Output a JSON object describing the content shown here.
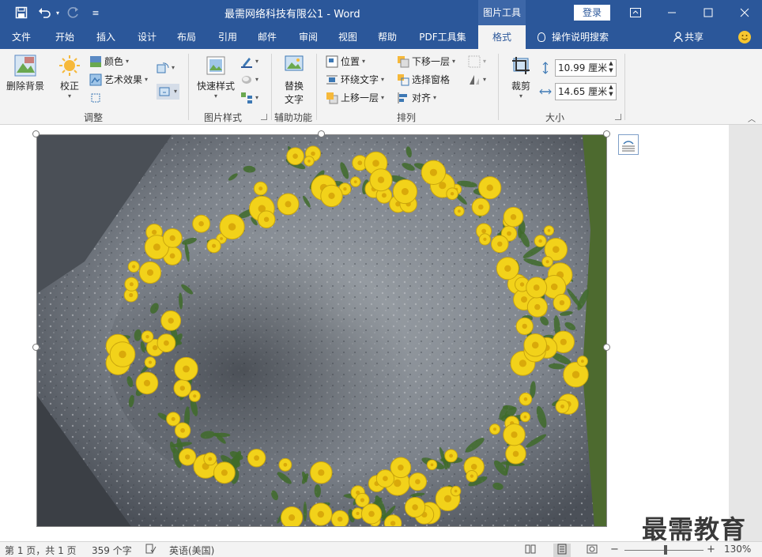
{
  "title_bar": {
    "document_title": "最需网络科技有限公1  -  Word",
    "context_tab": "图片工具",
    "login_label": "登录",
    "icons": [
      "save-icon",
      "undo-icon",
      "redo-icon",
      "customize-icon",
      "ribbon-display-icon",
      "minimize-icon",
      "maximize-icon",
      "close-icon"
    ]
  },
  "tabs": [
    {
      "label": "文件",
      "active": false
    },
    {
      "label": "开始",
      "active": false
    },
    {
      "label": "插入",
      "active": false
    },
    {
      "label": "设计",
      "active": false
    },
    {
      "label": "布局",
      "active": false
    },
    {
      "label": "引用",
      "active": false
    },
    {
      "label": "邮件",
      "active": false
    },
    {
      "label": "审阅",
      "active": false
    },
    {
      "label": "视图",
      "active": false
    },
    {
      "label": "帮助",
      "active": false
    },
    {
      "label": "PDF工具集",
      "active": false
    },
    {
      "label": "格式",
      "active": true
    }
  ],
  "tell_me": "操作说明搜索",
  "share": "共享",
  "ribbon": {
    "adjust": {
      "label": "调整",
      "remove_bg": "删除背景",
      "corrections": "校正",
      "color": "颜色",
      "artistic": "艺术效果"
    },
    "styles": {
      "label": "图片样式",
      "quick_styles": "快速样式"
    },
    "accessibility": {
      "label": "辅助功能",
      "alt_text_line1": "替换",
      "alt_text_line2": "文字"
    },
    "arrange": {
      "label": "排列",
      "position": "位置",
      "wrap_text": "环绕文字",
      "bring_forward": "上移一层",
      "send_backward": "下移一层",
      "selection_pane": "选择窗格",
      "align": "对齐"
    },
    "size": {
      "label": "大小",
      "crop": "裁剪",
      "height": "10.99 厘米",
      "width": "14.65 厘米"
    }
  },
  "status_bar": {
    "page": "第 1 页，共 1 页",
    "words": "359 个字",
    "language": "英语(美国)",
    "zoom_label": "130%",
    "zoom_minus": "−",
    "zoom_plus": "+"
  },
  "watermark": "最需教育",
  "colors": {
    "title_blue": "#2b579a",
    "ribbon_bg": "#f3f3f3",
    "flower_yellow": "#f2d21a",
    "leaf_green": "#3f6b2a",
    "stone_gray": "#8a8f96"
  }
}
